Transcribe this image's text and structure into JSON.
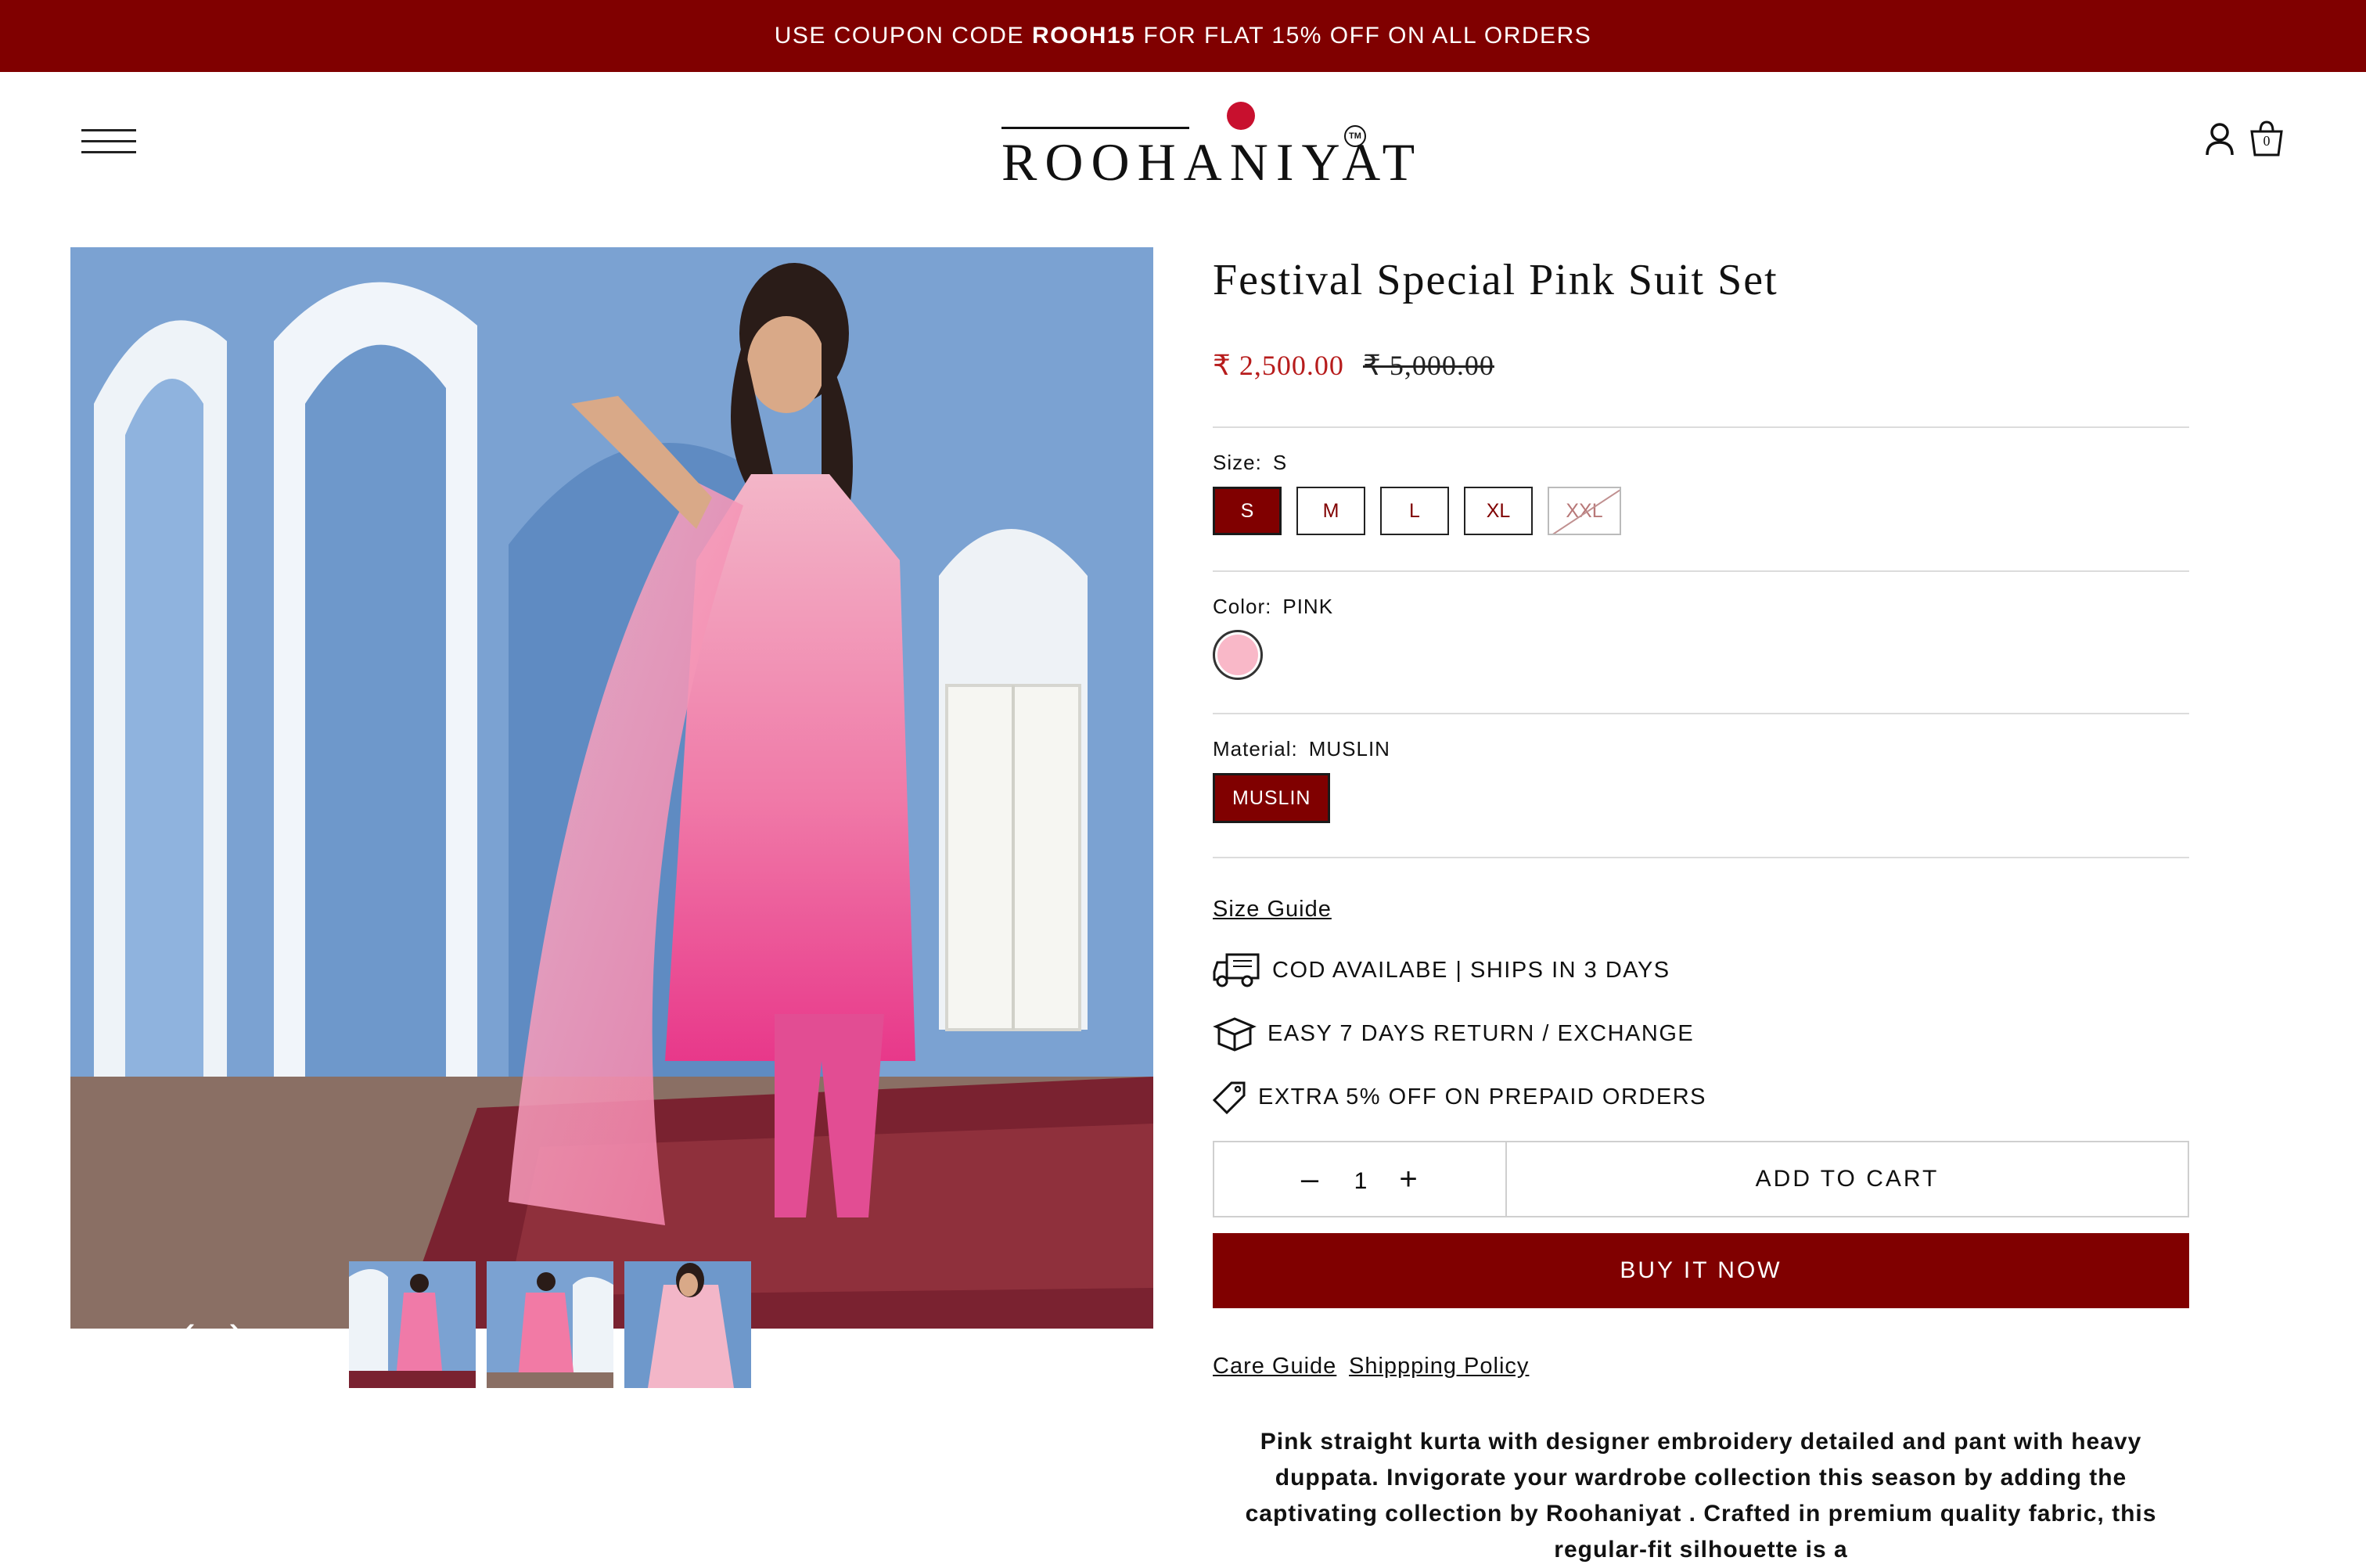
{
  "announcement": {
    "prefix": "USE COUPON CODE",
    "code": "ROOH15",
    "suffix": "FOR FLAT 15% OFF ON ALL ORDERS"
  },
  "header": {
    "logo_text": "ROOHANIYAT",
    "logo_tm": "TM",
    "cart_count": "0",
    "icons": [
      "menu-icon",
      "account-icon",
      "cart-icon"
    ]
  },
  "product": {
    "title": "Festival Special Pink Suit Set",
    "price_sale": "₹ 2,500.00",
    "price_compare": "₹ 5,000.00",
    "size": {
      "label": "Size:",
      "selected": "S",
      "options": [
        "S",
        "M",
        "L",
        "XL",
        "XXL"
      ],
      "unavailable": [
        "XXL"
      ]
    },
    "color": {
      "label": "Color:",
      "selected": "PINK",
      "swatch": "#f9b8c8"
    },
    "material": {
      "label": "Material:",
      "selected": "MUSLIN",
      "options": [
        "MUSLIN"
      ]
    },
    "size_guide": "Size Guide",
    "features": [
      {
        "icon": "delivery-truck-icon",
        "text": "COD AVAILABE | SHIPS IN 3 DAYS"
      },
      {
        "icon": "box-icon",
        "text": "EASY 7 DAYS RETURN / EXCHANGE"
      },
      {
        "icon": "tag-icon",
        "text": "EXTRA 5% OFF ON PREPAID ORDERS"
      }
    ],
    "quantity": "1",
    "add_to_cart": "ADD TO CART",
    "buy_now": "BUY IT NOW",
    "links": [
      "Care Guide",
      "Shippping Policy"
    ],
    "description": "Pink straight kurta with designer embroidery detailed and pant with heavy duppata. Invigorate your wardrobe collection this season by adding the captivating collection by Roohaniyat . Crafted in premium quality fabric, this regular-fit silhouette is a"
  },
  "gallery": {
    "arrows": [
      "‹",
      "›"
    ],
    "thumbnail_count": 3
  },
  "colors": {
    "brand": "#800000",
    "sale_price": "#b71c1c"
  }
}
